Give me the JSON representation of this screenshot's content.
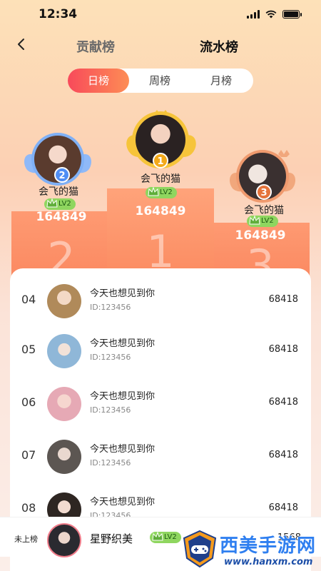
{
  "status": {
    "time": "12:34"
  },
  "nav": {
    "back_icon": "chevron-left-icon",
    "tabs": [
      {
        "label": "贡献榜"
      },
      {
        "label": "流水榜"
      }
    ]
  },
  "period": {
    "options": [
      {
        "label": "日榜"
      },
      {
        "label": "周榜"
      },
      {
        "label": "月榜"
      }
    ],
    "selected": "日榜"
  },
  "top3": [
    {
      "rank": "1",
      "name": "会飞的猫",
      "level": "LV2",
      "score": "164849",
      "badge_color": "#f3a91a"
    },
    {
      "rank": "2",
      "name": "会飞的猫",
      "level": "LV2",
      "score": "164849",
      "badge_color": "#4f8ef5"
    },
    {
      "rank": "3",
      "name": "会飞的猫",
      "level": "LV2",
      "score": "164849",
      "badge_color": "#e5743c"
    }
  ],
  "list": [
    {
      "rank": "04",
      "name": "今天也想见到你",
      "id": "ID:123456",
      "value": "68418"
    },
    {
      "rank": "05",
      "name": "今天也想见到你",
      "id": "ID:123456",
      "value": "68418"
    },
    {
      "rank": "06",
      "name": "今天也想见到你",
      "id": "ID:123456",
      "value": "68418"
    },
    {
      "rank": "07",
      "name": "今天也想见到你",
      "id": "ID:123456",
      "value": "68418"
    },
    {
      "rank": "08",
      "name": "今天也想见到你",
      "id": "ID:123456",
      "value": "68418"
    }
  ],
  "self": {
    "label": "未上榜",
    "name": "星野织美",
    "level": "LV2",
    "value": "1568"
  },
  "watermark": {
    "title": "西美手游网",
    "url": "www.hanxm.com"
  },
  "colors": {
    "accent_start": "#f84a5a",
    "accent_end": "#fd8d55",
    "podium": "#fb8a62",
    "level_tag": "#8fd65f"
  }
}
